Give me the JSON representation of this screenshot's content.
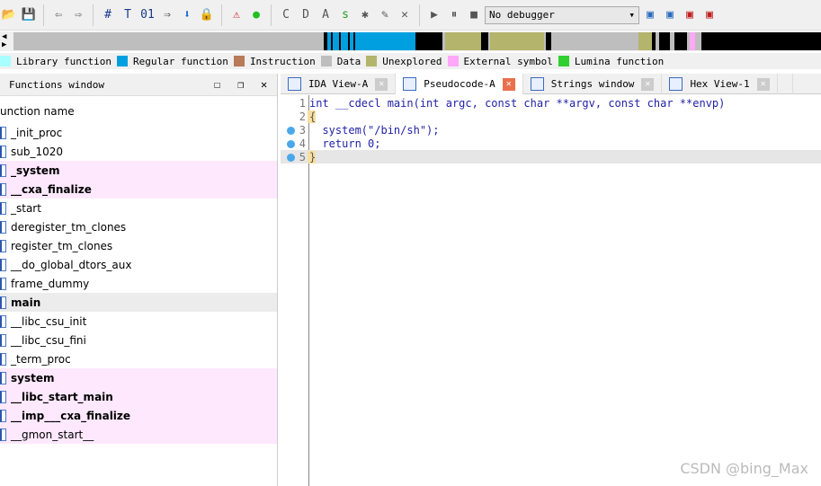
{
  "toolbar": {
    "debugger": "No debugger",
    "icons": [
      "open-icon",
      "save-icon",
      "back-icon",
      "forward-icon",
      "search-hash-icon",
      "search-text-icon",
      "search-binary-icon",
      "jump-icon",
      "down-arrow-icon",
      "lock-icon",
      "warning-icon",
      "green-circle-icon",
      "code-icon",
      "data-icon",
      "ascii-icon",
      "string-icon",
      "star-icon",
      "edit-icon",
      "close-x-icon",
      "play-icon",
      "pause-icon",
      "stop-icon"
    ]
  },
  "legend": [
    {
      "label": "Library function",
      "color": "#a8ffff"
    },
    {
      "label": "Regular function",
      "color": "#00a0e0"
    },
    {
      "label": "Instruction",
      "color": "#b87a58"
    },
    {
      "label": "Data",
      "color": "#bebebe"
    },
    {
      "label": "Unexplored",
      "color": "#b4b46c"
    },
    {
      "label": "External symbol",
      "color": "#ffa8f8"
    },
    {
      "label": "Lumina function",
      "color": "#30d030"
    }
  ],
  "functions_window": {
    "title": "Functions window",
    "column": "unction name",
    "rows": [
      {
        "name": "_init_proc",
        "style": ""
      },
      {
        "name": "sub_1020",
        "style": ""
      },
      {
        "name": "_system",
        "style": "pink bold"
      },
      {
        "name": "__cxa_finalize",
        "style": "pink bold"
      },
      {
        "name": "_start",
        "style": ""
      },
      {
        "name": "deregister_tm_clones",
        "style": ""
      },
      {
        "name": "register_tm_clones",
        "style": ""
      },
      {
        "name": "__do_global_dtors_aux",
        "style": ""
      },
      {
        "name": "frame_dummy",
        "style": ""
      },
      {
        "name": "main",
        "style": "sel bold"
      },
      {
        "name": "__libc_csu_init",
        "style": ""
      },
      {
        "name": "__libc_csu_fini",
        "style": ""
      },
      {
        "name": "_term_proc",
        "style": ""
      },
      {
        "name": "system",
        "style": "pink bold"
      },
      {
        "name": "__libc_start_main",
        "style": "pink bold"
      },
      {
        "name": "__imp___cxa_finalize",
        "style": "pink bold"
      },
      {
        "name": "__gmon_start__",
        "style": "pink"
      }
    ]
  },
  "tabs": [
    {
      "label": "IDA View-A",
      "active": false
    },
    {
      "label": "Pseudocode-A",
      "active": true
    },
    {
      "label": "Strings window",
      "active": false
    },
    {
      "label": "Hex View-1",
      "active": false
    }
  ],
  "code": [
    {
      "n": "1",
      "text": "int __cdecl main(int argc, const char **argv, const char **envp)",
      "dot": false
    },
    {
      "n": "2",
      "text": "{",
      "dot": false
    },
    {
      "n": "3",
      "text": "  system(\"/bin/sh\");",
      "dot": true
    },
    {
      "n": "4",
      "text": "  return 0;",
      "dot": true
    },
    {
      "n": "5",
      "text": "}",
      "dot": true
    }
  ],
  "watermark": "CSDN @bing_Max"
}
